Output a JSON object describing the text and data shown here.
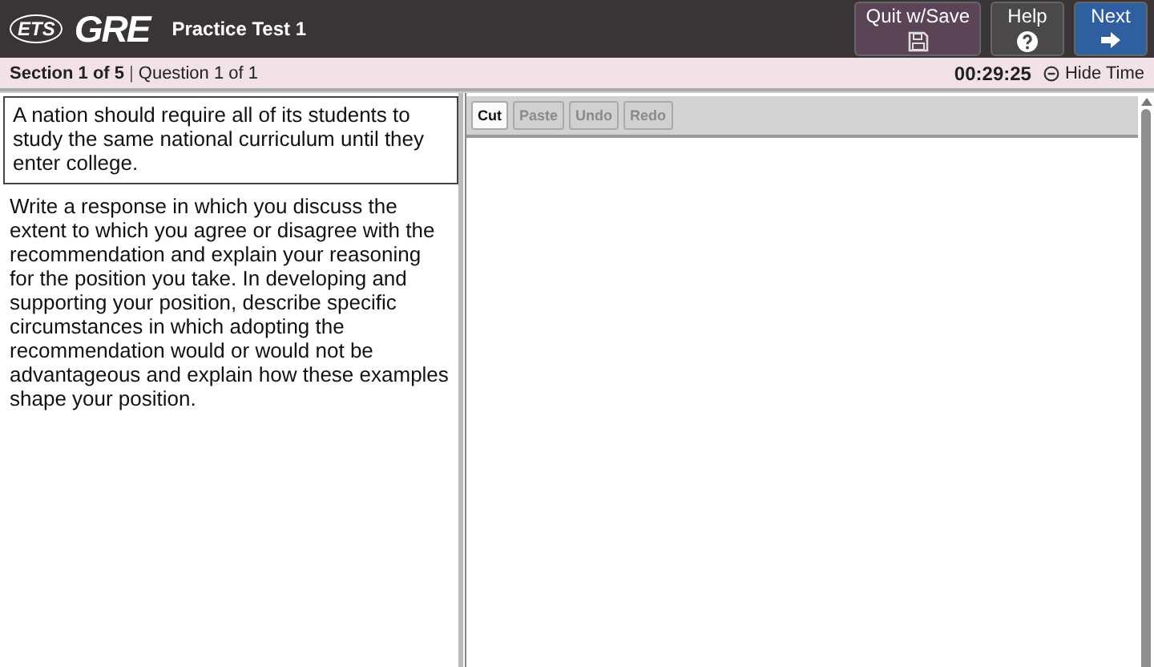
{
  "header": {
    "logo": "ETS",
    "product": "GRE",
    "title": "Practice Test 1",
    "buttons": [
      {
        "label": "Quit w/Save",
        "kind": "save"
      },
      {
        "label": "Help",
        "kind": "help"
      },
      {
        "label": "Next",
        "kind": "next"
      }
    ]
  },
  "status_bar": {
    "section": "Section 1 of 5",
    "separator": "|",
    "question": "Question 1 of 1",
    "timer": "00:29:25",
    "timer_toggle": "Hide Time"
  },
  "prompt": "A nation should require all of its students to study the same national curriculum until they enter college.",
  "instructions": "Write a response in which you discuss the extent to which you agree or disagree with the recommendation and explain your reasoning for the position you take. In developing and supporting your position, describe specific circumstances in which adopting the recommendation would or would not be advantageous and explain how these examples shape your position.",
  "editor": {
    "buttons": [
      {
        "label": "Cut",
        "disabled": false
      },
      {
        "label": "Paste",
        "disabled": true
      },
      {
        "label": "Undo",
        "disabled": true
      },
      {
        "label": "Redo",
        "disabled": true
      }
    ]
  }
}
